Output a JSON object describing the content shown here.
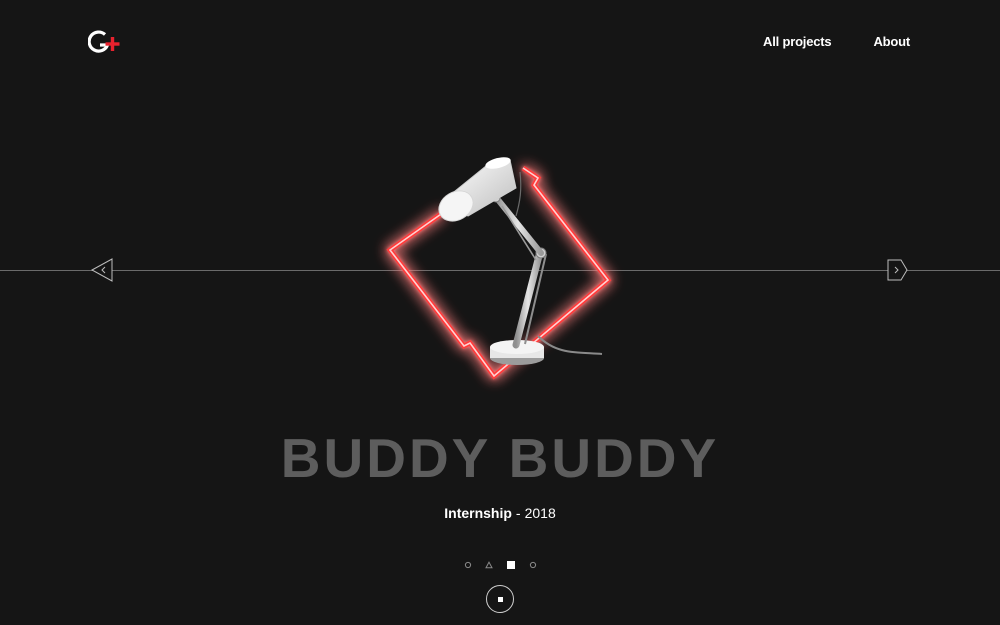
{
  "header": {
    "logo_icon": "g-plus-logo-icon",
    "nav": [
      {
        "label": "All projects"
      },
      {
        "label": "About"
      }
    ]
  },
  "slider": {
    "prev_icon": "chevron-left-triangle-icon",
    "next_icon": "chevron-right-pentagon-icon"
  },
  "project": {
    "title": "BUDDY BUDDY",
    "type": "Internship",
    "separator": "-",
    "year": "2018",
    "image_icon": "desk-lamp-neon-diamond-icon"
  },
  "pagination": {
    "count": 4,
    "active_index": 2,
    "shapes": [
      "circle",
      "triangle",
      "square",
      "circle"
    ]
  },
  "colors": {
    "background": "#151515",
    "neon": "#ff2a2a",
    "accent_red": "#e8222e",
    "title": "#5d5d5d",
    "text": "#ffffff"
  }
}
